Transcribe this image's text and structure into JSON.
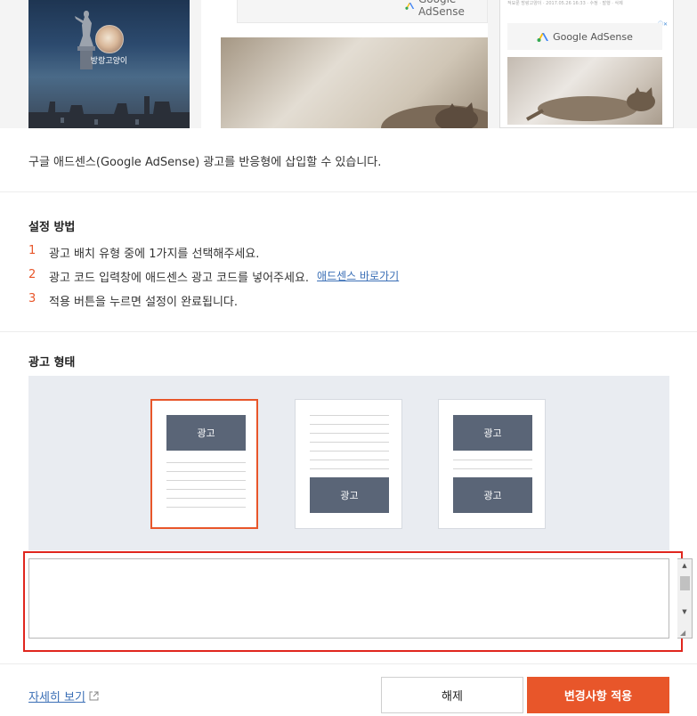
{
  "preview": {
    "blog_name": "방랑고양이",
    "ad_brand": "Google AdSense",
    "mobile_meta": "적묘룬 방랑고양이 · 2017.05.26 16:33 · 수정 · 발행 · 삭제",
    "mobile_ad_tag": "ⓘ✕"
  },
  "intro": "구글 애드센스(Google AdSense) 광고를 반응형에 삽입할 수 있습니다.",
  "setup": {
    "title": "설정 방법",
    "steps": [
      {
        "num": "1",
        "text": "광고 배치 유형 중에 1가지를 선택해주세요."
      },
      {
        "num": "2",
        "text": "광고 코드 입력창에 애드센스 광고 코드를 넣어주세요."
      },
      {
        "num": "3",
        "text": "적용 버튼을 누르면 설정이 완료됩니다."
      }
    ],
    "adsense_link": "애드센스 바로가기"
  },
  "ad_type": {
    "title": "광고 형태",
    "ad_label": "광고",
    "options": [
      {
        "name": "top",
        "selected": true
      },
      {
        "name": "bottom",
        "selected": false
      },
      {
        "name": "top-bottom",
        "selected": false
      }
    ]
  },
  "code_input": {
    "value": "",
    "placeholder": ""
  },
  "footer": {
    "more_link": "자세히 보기",
    "cancel_label": "해제",
    "apply_label": "변경사항 적용"
  },
  "colors": {
    "accent": "#e8562a",
    "ad_block": "#5a6577",
    "highlight_border": "#e0261e",
    "link": "#3b6fb6"
  }
}
